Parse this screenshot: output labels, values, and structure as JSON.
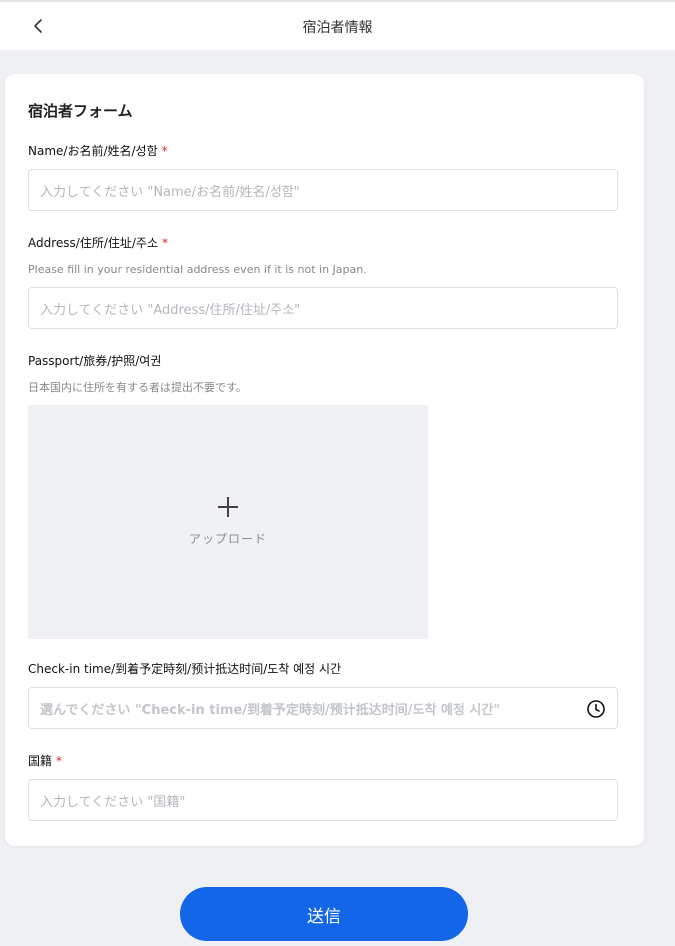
{
  "header": {
    "title": "宿泊者情報"
  },
  "form": {
    "title": "宿泊者フォーム",
    "name": {
      "label": "Name/お名前/姓名/성함",
      "required_mark": "*",
      "placeholder": "入力してください \"Name/お名前/姓名/성함\""
    },
    "address": {
      "label": "Address/住所/住址/주소",
      "required_mark": "*",
      "hint": "Please fill in your residential address even if it is not in Japan.",
      "placeholder": "入力してください \"Address/住所/住址/주소\""
    },
    "passport": {
      "label": "Passport/旅券/护照/여권",
      "hint": "日本国内に住所を有する者は提出不要です。",
      "upload_label": "アップロード"
    },
    "checkin": {
      "label": "Check-in time/到着予定時刻/预计抵达时间/도착 예정 시간",
      "placeholder": "選んでください \"Check-in time/到着予定時刻/预计抵达时间/도착 예정 시간\""
    },
    "nationality": {
      "label": "国籍",
      "required_mark": "*",
      "placeholder": "入力してください \"国籍\""
    }
  },
  "submit_label": "送信",
  "colors": {
    "primary": "#1366e8",
    "required": "#e0262b",
    "background": "#eef0f4"
  }
}
